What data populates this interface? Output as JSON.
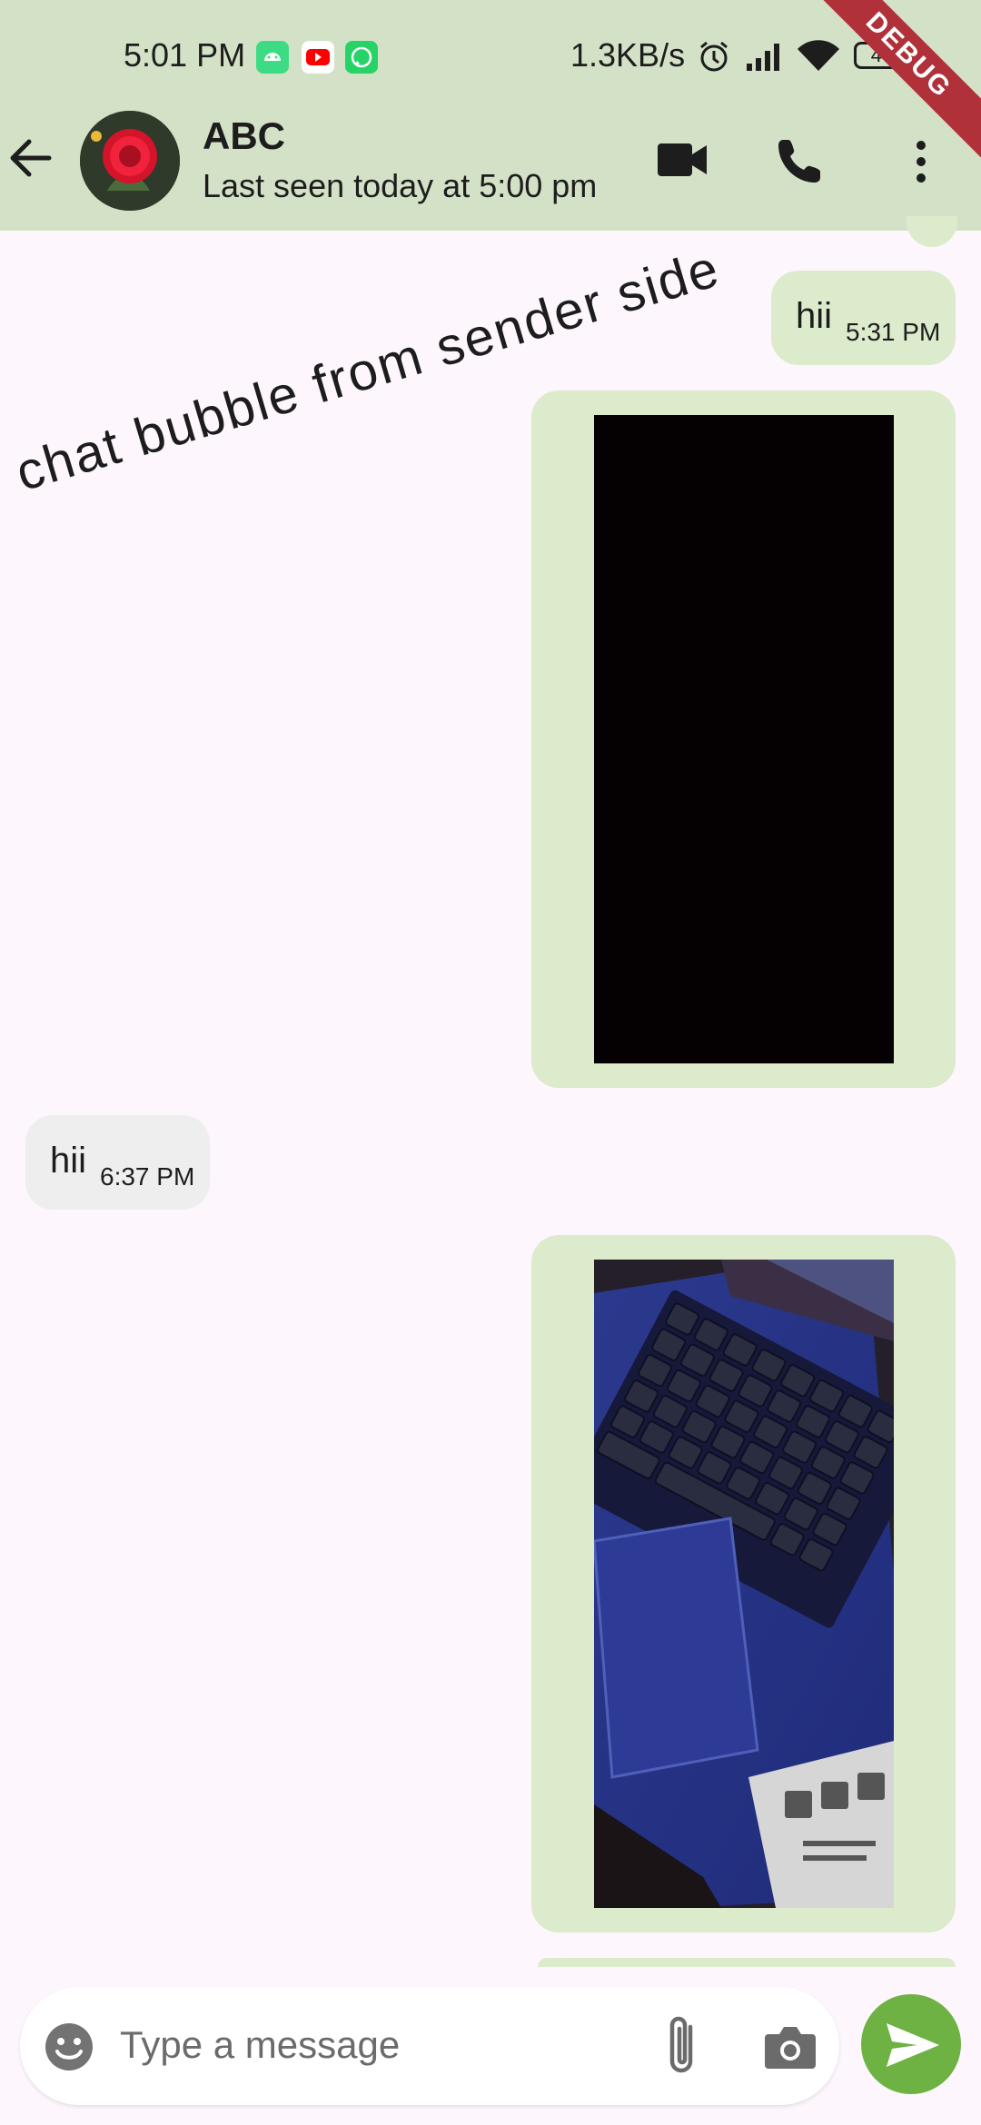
{
  "status_bar": {
    "time": "5:01 PM",
    "app_icons": [
      "android-robot-icon",
      "youtube-icon",
      "whatsapp-icon"
    ],
    "net_speed": "1.3KB/s",
    "battery": "44",
    "right_icons": [
      "alarm-icon",
      "signal-icon",
      "wifi-icon",
      "battery-icon"
    ]
  },
  "debug_banner": "DEBUG",
  "header": {
    "contact_name": "ABC",
    "last_seen": "Last seen today at 5:00 pm",
    "actions": [
      "video-call-icon",
      "phone-icon",
      "more-vert-icon"
    ]
  },
  "overlay_label": "chat bubble from sender side",
  "messages": [
    {
      "direction": "outgoing",
      "type": "text",
      "text": "hii",
      "time": "5:31 PM"
    },
    {
      "direction": "outgoing",
      "type": "image",
      "image": "black-image"
    },
    {
      "direction": "incoming",
      "type": "text",
      "text": "hii",
      "time": "6:37 PM"
    },
    {
      "direction": "outgoing",
      "type": "image",
      "image": "laptop-keyboard-photo"
    }
  ],
  "composer": {
    "placeholder": "Type a message",
    "icons": [
      "emoji-icon",
      "attach-icon",
      "camera-icon",
      "send-icon"
    ]
  },
  "colors": {
    "appbar": "#d3e2c7",
    "background": "#fdf7fd",
    "outgoing_bubble": "#dcebcb",
    "incoming_bubble": "#eeeeee",
    "send_button": "#6eb243",
    "debug_banner": "#b0313a"
  }
}
